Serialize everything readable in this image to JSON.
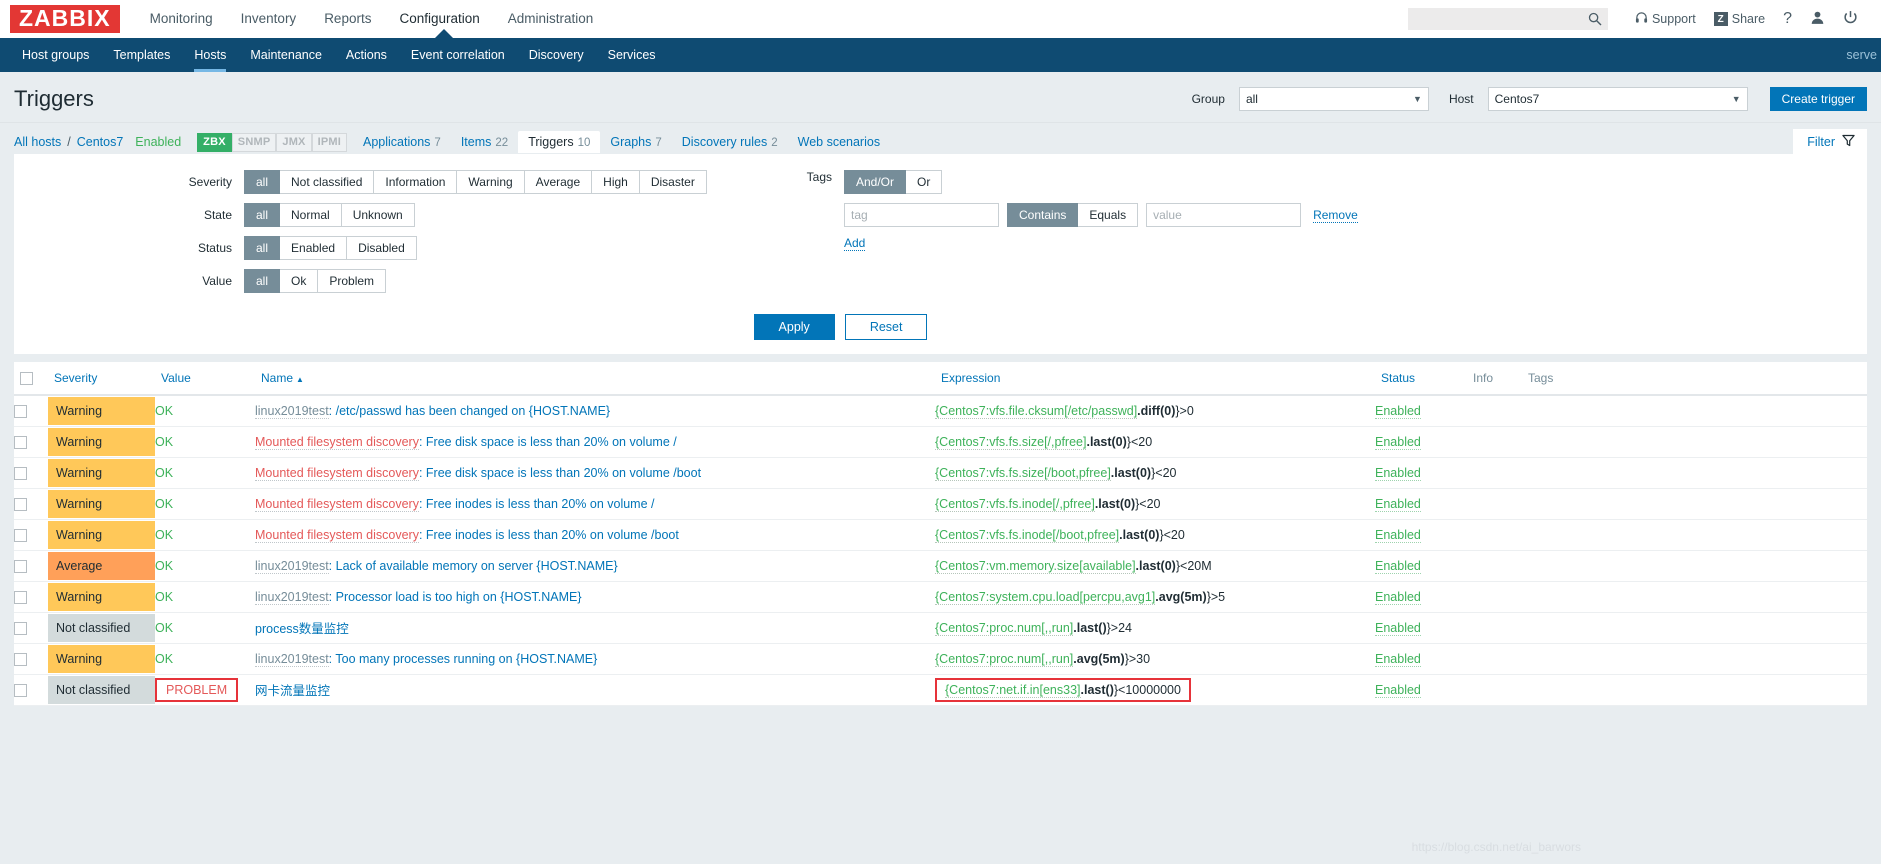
{
  "header": {
    "logo_text": "ZABBIX",
    "nav": [
      {
        "label": "Monitoring",
        "selected": false
      },
      {
        "label": "Inventory",
        "selected": false
      },
      {
        "label": "Reports",
        "selected": false
      },
      {
        "label": "Configuration",
        "selected": true
      },
      {
        "label": "Administration",
        "selected": false
      }
    ],
    "search_placeholder": "",
    "search_value": "",
    "support_label": "Support",
    "share_label": "Share",
    "share_badge": "Z",
    "help_label": "?",
    "user_icon": "user-icon",
    "signout_icon": "power-icon"
  },
  "subnav": {
    "items": [
      {
        "label": "Host groups",
        "selected": false
      },
      {
        "label": "Templates",
        "selected": false
      },
      {
        "label": "Hosts",
        "selected": true
      },
      {
        "label": "Maintenance",
        "selected": false
      },
      {
        "label": "Actions",
        "selected": false
      },
      {
        "label": "Event correlation",
        "selected": false
      },
      {
        "label": "Discovery",
        "selected": false
      },
      {
        "label": "Services",
        "selected": false
      }
    ],
    "server_name": "serve"
  },
  "page": {
    "title": "Triggers",
    "group_label": "Group",
    "group_value": "all",
    "host_label": "Host",
    "host_value": "Centos7",
    "create_button": "Create trigger"
  },
  "breadcrumb": {
    "all_hosts": "All hosts",
    "separator": "/",
    "host": "Centos7",
    "enabled": "Enabled",
    "protocols": [
      {
        "label": "ZBX",
        "active": true
      },
      {
        "label": "SNMP",
        "active": false
      },
      {
        "label": "JMX",
        "active": false
      },
      {
        "label": "IPMI",
        "active": false
      }
    ],
    "tabs": [
      {
        "label": "Applications",
        "count": "7",
        "active": false
      },
      {
        "label": "Items",
        "count": "22",
        "active": false
      },
      {
        "label": "Triggers",
        "count": "10",
        "active": true
      },
      {
        "label": "Graphs",
        "count": "7",
        "active": false
      },
      {
        "label": "Discovery rules",
        "count": "2",
        "active": false
      },
      {
        "label": "Web scenarios",
        "count": "",
        "active": false
      }
    ],
    "filter_label": "Filter"
  },
  "filter": {
    "severity": {
      "label": "Severity",
      "options": [
        "all",
        "Not classified",
        "Information",
        "Warning",
        "Average",
        "High",
        "Disaster"
      ],
      "selected": "all"
    },
    "state": {
      "label": "State",
      "options": [
        "all",
        "Normal",
        "Unknown"
      ],
      "selected": "all"
    },
    "status": {
      "label": "Status",
      "options": [
        "all",
        "Enabled",
        "Disabled"
      ],
      "selected": "all"
    },
    "value": {
      "label": "Value",
      "options": [
        "all",
        "Ok",
        "Problem"
      ],
      "selected": "all"
    },
    "tags": {
      "label": "Tags",
      "operator_options": [
        "And/Or",
        "Or"
      ],
      "operator_selected": "And/Or",
      "tag_placeholder": "tag",
      "tag_value": "",
      "match_options": [
        "Contains",
        "Equals"
      ],
      "match_selected": "Contains",
      "value_placeholder": "value",
      "value_value": "",
      "remove_label": "Remove",
      "add_label": "Add"
    },
    "apply_label": "Apply",
    "reset_label": "Reset"
  },
  "table": {
    "columns": [
      "Severity",
      "Value",
      "Name",
      "Expression",
      "Status",
      "Info",
      "Tags"
    ],
    "sort_column": "Name",
    "sort_direction": "asc",
    "rows": [
      {
        "severity": "Warning",
        "severity_class": "sev-warning",
        "value": "OK",
        "value_state": "ok",
        "value_highlight": false,
        "name_prefix": "linux2019test",
        "name_prefix_type": "host",
        "name": ": /etc/passwd has been changed on {HOST.NAME}",
        "expr_item": "{Centos7:vfs.file.cksum[/etc/passwd]",
        "expr_fn": ".diff(0)",
        "expr_tail": "}>0",
        "expr_highlight": false,
        "status": "Enabled",
        "info": "",
        "tags": ""
      },
      {
        "severity": "Warning",
        "severity_class": "sev-warning",
        "value": "OK",
        "value_state": "ok",
        "value_highlight": false,
        "name_prefix": "Mounted filesystem discovery",
        "name_prefix_type": "proto",
        "name": ": Free disk space is less than 20% on volume /",
        "expr_item": "{Centos7:vfs.fs.size[/,pfree]",
        "expr_fn": ".last(0)",
        "expr_tail": "}<20",
        "expr_highlight": false,
        "status": "Enabled",
        "info": "",
        "tags": ""
      },
      {
        "severity": "Warning",
        "severity_class": "sev-warning",
        "value": "OK",
        "value_state": "ok",
        "value_highlight": false,
        "name_prefix": "Mounted filesystem discovery",
        "name_prefix_type": "proto",
        "name": ": Free disk space is less than 20% on volume /boot",
        "expr_item": "{Centos7:vfs.fs.size[/boot,pfree]",
        "expr_fn": ".last(0)",
        "expr_tail": "}<20",
        "expr_highlight": false,
        "status": "Enabled",
        "info": "",
        "tags": ""
      },
      {
        "severity": "Warning",
        "severity_class": "sev-warning",
        "value": "OK",
        "value_state": "ok",
        "value_highlight": false,
        "name_prefix": "Mounted filesystem discovery",
        "name_prefix_type": "proto",
        "name": ": Free inodes is less than 20% on volume /",
        "expr_item": "{Centos7:vfs.fs.inode[/,pfree]",
        "expr_fn": ".last(0)",
        "expr_tail": "}<20",
        "expr_highlight": false,
        "status": "Enabled",
        "info": "",
        "tags": ""
      },
      {
        "severity": "Warning",
        "severity_class": "sev-warning",
        "value": "OK",
        "value_state": "ok",
        "value_highlight": false,
        "name_prefix": "Mounted filesystem discovery",
        "name_prefix_type": "proto",
        "name": ": Free inodes is less than 20% on volume /boot",
        "expr_item": "{Centos7:vfs.fs.inode[/boot,pfree]",
        "expr_fn": ".last(0)",
        "expr_tail": "}<20",
        "expr_highlight": false,
        "status": "Enabled",
        "info": "",
        "tags": ""
      },
      {
        "severity": "Average",
        "severity_class": "sev-average",
        "value": "OK",
        "value_state": "ok",
        "value_highlight": false,
        "name_prefix": "linux2019test",
        "name_prefix_type": "host",
        "name": ": Lack of available memory on server {HOST.NAME}",
        "expr_item": "{Centos7:vm.memory.size[available]",
        "expr_fn": ".last(0)",
        "expr_tail": "}<20M",
        "expr_highlight": false,
        "status": "Enabled",
        "info": "",
        "tags": ""
      },
      {
        "severity": "Warning",
        "severity_class": "sev-warning",
        "value": "OK",
        "value_state": "ok",
        "value_highlight": false,
        "name_prefix": "linux2019test",
        "name_prefix_type": "host",
        "name": ": Processor load is too high on {HOST.NAME}",
        "expr_item": "{Centos7:system.cpu.load[percpu,avg1]",
        "expr_fn": ".avg(5m)",
        "expr_tail": "}>5",
        "expr_highlight": false,
        "status": "Enabled",
        "info": "",
        "tags": ""
      },
      {
        "severity": "Not classified",
        "severity_class": "sev-notclassified",
        "value": "OK",
        "value_state": "ok",
        "value_highlight": false,
        "name_prefix": "",
        "name_prefix_type": "none",
        "name": "process数量监控",
        "expr_item": "{Centos7:proc.num[,,run]",
        "expr_fn": ".last()",
        "expr_tail": "}>24",
        "expr_highlight": false,
        "status": "Enabled",
        "info": "",
        "tags": ""
      },
      {
        "severity": "Warning",
        "severity_class": "sev-warning",
        "value": "OK",
        "value_state": "ok",
        "value_highlight": false,
        "name_prefix": "linux2019test",
        "name_prefix_type": "host",
        "name": ": Too many processes running on {HOST.NAME}",
        "expr_item": "{Centos7:proc.num[,,run]",
        "expr_fn": ".avg(5m)",
        "expr_tail": "}>30",
        "expr_highlight": false,
        "status": "Enabled",
        "info": "",
        "tags": ""
      },
      {
        "severity": "Not classified",
        "severity_class": "sev-notclassified",
        "value": "PROBLEM",
        "value_state": "problem",
        "value_highlight": true,
        "name_prefix": "",
        "name_prefix_type": "none",
        "name": "网卡流量监控",
        "expr_item": "{Centos7:net.if.in[ens33]",
        "expr_fn": ".last()",
        "expr_tail": "}<10000000",
        "expr_highlight": true,
        "status": "Enabled",
        "info": "",
        "tags": ""
      }
    ]
  }
}
